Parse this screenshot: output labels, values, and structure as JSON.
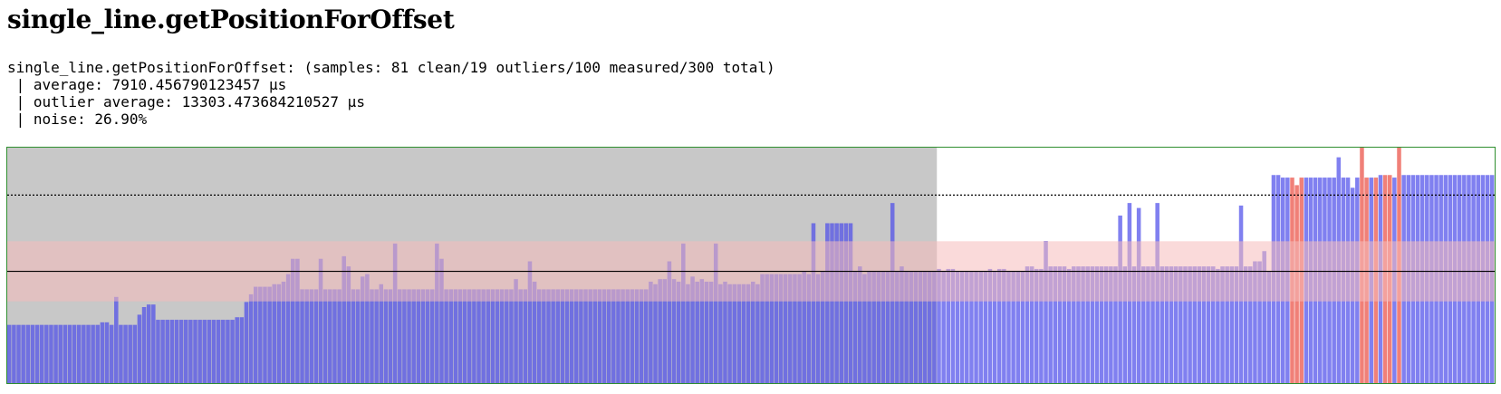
{
  "title": "single_line.getPositionForOffset",
  "summary": {
    "line1": "single_line.getPositionForOffset: (samples: 81 clean/19 outliers/100 measured/300 total)",
    "line2": " | average: 7910.456790123457 µs",
    "line3": " | outlier average: 13303.473684210527 µs",
    "line4": " | noise: 26.90%"
  },
  "chart_data": {
    "type": "bar",
    "total_samples": 300,
    "warmup_samples": 200,
    "measured_samples": 100,
    "average": 7910.456790123457,
    "outlier_average": 13303.473684210527,
    "noise_percent": 26.9,
    "ylim": [
      0,
      16660
    ],
    "grid": false,
    "colors": {
      "warmup_region": "#c8c8c8",
      "warmup_bar": "#7070e0",
      "clean_bar": "#8080f0",
      "outlier_bar": "#f08078",
      "noise_band": "#f5bcbc",
      "average_line": "#000000",
      "outlier_average_line": "#000000",
      "border": "#2f8f2f"
    },
    "values": [
      4122,
      4122,
      4122,
      4122,
      4122,
      4122,
      4122,
      4122,
      4122,
      4122,
      4122,
      4122,
      4122,
      4122,
      4122,
      4122,
      4122,
      4122,
      4122,
      4122,
      4303,
      4303,
      4122,
      6099,
      4122,
      4122,
      4122,
      4122,
      4842,
      5382,
      5562,
      5562,
      4482,
      4482,
      4482,
      4482,
      4482,
      4482,
      4482,
      4482,
      4482,
      4482,
      4482,
      4482,
      4482,
      4482,
      4482,
      4482,
      4482,
      4663,
      4663,
      5742,
      6283,
      6820,
      6820,
      6820,
      6820,
      7000,
      7000,
      7179,
      7717,
      8797,
      8797,
      6638,
      6638,
      6638,
      6638,
      8797,
      6638,
      6638,
      6638,
      6638,
      8978,
      8257,
      6638,
      6638,
      7540,
      7717,
      6638,
      6638,
      6998,
      6638,
      6638,
      9875,
      6638,
      6638,
      6638,
      6638,
      6638,
      6638,
      6638,
      6638,
      9875,
      8797,
      6638,
      6638,
      6638,
      6638,
      6638,
      6638,
      6638,
      6638,
      6638,
      6638,
      6638,
      6638,
      6638,
      6638,
      6638,
      7358,
      6638,
      6638,
      8617,
      7179,
      6638,
      6638,
      6638,
      6638,
      6638,
      6638,
      6638,
      6638,
      6638,
      6638,
      6638,
      6638,
      6638,
      6638,
      6638,
      6638,
      6638,
      6638,
      6638,
      6638,
      6638,
      6638,
      6638,
      6638,
      7179,
      6998,
      7358,
      7358,
      8617,
      7358,
      7179,
      9875,
      6998,
      7540,
      7179,
      7358,
      7179,
      7179,
      9875,
      6998,
      7179,
      6998,
      6998,
      6998,
      6998,
      6998,
      7179,
      6998,
      7717,
      7717,
      7717,
      7717,
      7717,
      7717,
      7717,
      7717,
      7717,
      7897,
      7717,
      11312,
      7717,
      7897,
      11312,
      11312,
      11312,
      11312,
      11312,
      11312,
      7897,
      8257,
      7717,
      7897,
      7897,
      7897,
      7897,
      7897,
      12743,
      7897,
      8257,
      7897,
      7897,
      7897,
      7897,
      7897,
      7897,
      7897,
      8078,
      7897,
      8078,
      8078,
      7897,
      7897,
      7897,
      7897,
      7897,
      7897,
      7897,
      8078,
      7897,
      8078,
      8078,
      7897,
      7897,
      7897,
      7897,
      8257,
      8257,
      8078,
      8078,
      10054,
      8257,
      8257,
      8257,
      8257,
      8078,
      8257,
      8257,
      8257,
      8257,
      8257,
      8257,
      8257,
      8257,
      8257,
      8257,
      11854,
      8257,
      12743,
      8257,
      12391,
      8257,
      8257,
      8257,
      12743,
      8257,
      8257,
      8257,
      8257,
      8257,
      8257,
      8257,
      8257,
      8257,
      8257,
      8257,
      8257,
      8078,
      8257,
      8257,
      8257,
      8257,
      12562,
      8257,
      8257,
      8617,
      8617,
      9339,
      7897,
      14722,
      14722,
      14541,
      14541,
      14541,
      14006,
      14541,
      14541,
      14541,
      14541,
      14541,
      14541,
      14541,
      14541,
      15976,
      14541,
      14541,
      13822,
      14541,
      17259,
      14541,
      14541,
      14541,
      14722,
      14722,
      14722,
      14541,
      17259,
      14722,
      14722,
      14722,
      14722,
      14722,
      14722,
      14722,
      14722,
      14722,
      14722,
      14722,
      14722,
      14722,
      14722,
      14722,
      14722,
      14722,
      14722,
      14722,
      14722
    ],
    "outlier_indices": [
      276,
      277,
      278,
      291,
      292,
      294,
      296,
      297,
      299
    ]
  }
}
